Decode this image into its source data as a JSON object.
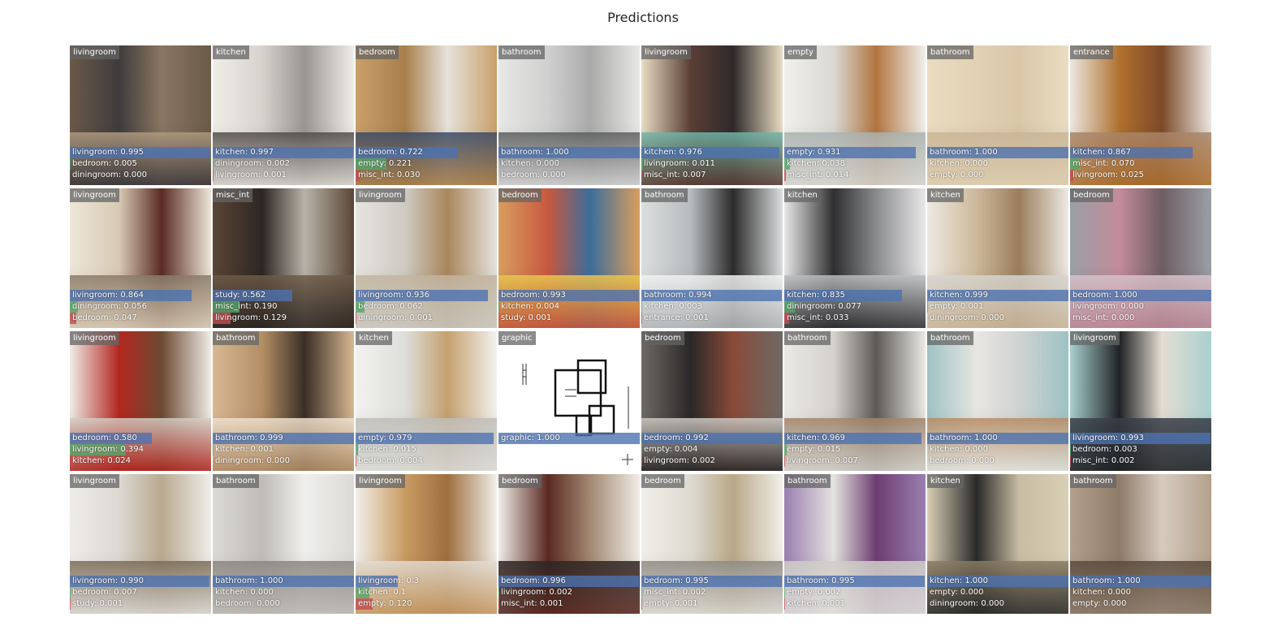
{
  "title": "Predictions",
  "colors": {
    "bar_top": "#4c72b0",
    "bar_second": "#55a868",
    "bar_third": "#c44e52",
    "label_bg": "#646464"
  },
  "tiles": [
    {
      "label": "livingroom",
      "palette": [
        "#6b5a49",
        "#3f3b3d",
        "#8a7662",
        "#b09a80"
      ],
      "preds": [
        {
          "name": "livingroom",
          "score": "0.995",
          "p": 0.995
        },
        {
          "name": "bedroom",
          "score": "0.005",
          "p": 0.005
        },
        {
          "name": "diningroom",
          "score": "0.000",
          "p": 0.0
        }
      ]
    },
    {
      "label": "kitchen",
      "palette": [
        "#f0ede8",
        "#d7d2cc",
        "#9a9590",
        "#514c48"
      ],
      "preds": [
        {
          "name": "kitchen",
          "score": "0.997",
          "p": 0.997
        },
        {
          "name": "diningroom",
          "score": "0.002",
          "p": 0.002
        },
        {
          "name": "livingroom",
          "score": "0.001",
          "p": 0.001
        }
      ]
    },
    {
      "label": "bedroom",
      "palette": [
        "#c9a06a",
        "#a87f4b",
        "#e6e2dc",
        "#3a4a68"
      ],
      "preds": [
        {
          "name": "bedroom",
          "score": "0.722",
          "p": 0.722
        },
        {
          "name": "empty",
          "score": "0.221",
          "p": 0.221
        },
        {
          "name": "misc_int",
          "score": "0.030",
          "p": 0.03
        }
      ]
    },
    {
      "label": "bathroom",
      "palette": [
        "#e8e8e6",
        "#cfd0cf",
        "#a9aaa9",
        "#5d5e5e"
      ],
      "preds": [
        {
          "name": "bathroom",
          "score": "1.000",
          "p": 1.0
        },
        {
          "name": "kitchen",
          "score": "0.000",
          "p": 0.0
        },
        {
          "name": "bedroom",
          "score": "0.000",
          "p": 0.0
        }
      ]
    },
    {
      "label": "livingroom",
      "palette": [
        "#e9dcc3",
        "#5a3e35",
        "#2f2a2a",
        "#6fb5a8"
      ],
      "preds": [
        {
          "name": "kitchen",
          "score": "0.976",
          "p": 0.976
        },
        {
          "name": "livingroom",
          "score": "0.011",
          "p": 0.011
        },
        {
          "name": "misc_int",
          "score": "0.007",
          "p": 0.007
        }
      ]
    },
    {
      "label": "empty",
      "palette": [
        "#f1f0ec",
        "#dad8d2",
        "#b27540",
        "#a9b2b0"
      ],
      "preds": [
        {
          "name": "empty",
          "score": "0.931",
          "p": 0.931
        },
        {
          "name": "kitchen",
          "score": "0.038",
          "p": 0.038
        },
        {
          "name": "misc_int",
          "score": "0.014",
          "p": 0.014
        }
      ]
    },
    {
      "label": "bathroom",
      "palette": [
        "#eadcc2",
        "#e2d1b3",
        "#d9c7a7",
        "#c9b595"
      ],
      "preds": [
        {
          "name": "bathroom",
          "score": "1.000",
          "p": 1.0
        },
        {
          "name": "kitchen",
          "score": "0.000",
          "p": 0.0
        },
        {
          "name": "empty",
          "score": "0.000",
          "p": 0.0
        }
      ]
    },
    {
      "label": "entrance",
      "palette": [
        "#ece8e2",
        "#b0702f",
        "#7d4a28",
        "#a9856a"
      ],
      "preds": [
        {
          "name": "kitchen",
          "score": "0.867",
          "p": 0.867
        },
        {
          "name": "misc_int",
          "score": "0.070",
          "p": 0.07
        },
        {
          "name": "livingroom",
          "score": "0.025",
          "p": 0.025
        }
      ]
    },
    {
      "label": "livingroom",
      "palette": [
        "#eee6d8",
        "#d7c9b3",
        "#5a2b24",
        "#8a7a68"
      ],
      "preds": [
        {
          "name": "livingroom",
          "score": "0.864",
          "p": 0.864
        },
        {
          "name": "diningroom",
          "score": "0.056",
          "p": 0.056
        },
        {
          "name": "bedroom",
          "score": "0.047",
          "p": 0.047
        }
      ]
    },
    {
      "label": "misc_int",
      "palette": [
        "#5a4637",
        "#2d2622",
        "#b8b3a8",
        "#6e5b48"
      ],
      "preds": [
        {
          "name": "study",
          "score": "0.562",
          "p": 0.562
        },
        {
          "name": "misc_int",
          "score": "0.190",
          "p": 0.19
        },
        {
          "name": "livingroom",
          "score": "0.129",
          "p": 0.129
        }
      ]
    },
    {
      "label": "livingroom",
      "palette": [
        "#e6e4df",
        "#cfcac2",
        "#a9875d",
        "#c2b59e"
      ],
      "preds": [
        {
          "name": "livingroom",
          "score": "0.936",
          "p": 0.936
        },
        {
          "name": "bedroom",
          "score": "0.062",
          "p": 0.062
        },
        {
          "name": "diningroom",
          "score": "0.001",
          "p": 0.001
        }
      ]
    },
    {
      "label": "bedroom",
      "palette": [
        "#d99e5e",
        "#c8583f",
        "#3d6d9b",
        "#e8c84f"
      ],
      "preds": [
        {
          "name": "bedroom",
          "score": "0.993",
          "p": 0.993
        },
        {
          "name": "kitchen",
          "score": "0.004",
          "p": 0.004
        },
        {
          "name": "study",
          "score": "0.001",
          "p": 0.001
        }
      ]
    },
    {
      "label": "bathroom",
      "palette": [
        "#dcdedf",
        "#b7babc",
        "#2b2b2b",
        "#f2f2f2"
      ],
      "preds": [
        {
          "name": "bathroom",
          "score": "0.994",
          "p": 0.994
        },
        {
          "name": "kitchen",
          "score": "0.003",
          "p": 0.003
        },
        {
          "name": "entrance",
          "score": "0.001",
          "p": 0.001
        }
      ]
    },
    {
      "label": "kitchen",
      "palette": [
        "#e8e8e8",
        "#2f2f31",
        "#8a8b8d",
        "#bdbebf"
      ],
      "preds": [
        {
          "name": "kitchen",
          "score": "0.835",
          "p": 0.835
        },
        {
          "name": "diningroom",
          "score": "0.077",
          "p": 0.077
        },
        {
          "name": "misc_int",
          "score": "0.033",
          "p": 0.033
        }
      ]
    },
    {
      "label": "kitchen",
      "palette": [
        "#ede9e3",
        "#cdb89a",
        "#9a7e5d",
        "#d6d4d0"
      ],
      "preds": [
        {
          "name": "kitchen",
          "score": "0.999",
          "p": 0.999
        },
        {
          "name": "empty",
          "score": "0.001",
          "p": 0.001
        },
        {
          "name": "diningroom",
          "score": "0.000",
          "p": 0.0
        }
      ]
    },
    {
      "label": "bedroom",
      "palette": [
        "#9aa0a5",
        "#c38b9b",
        "#6e5d63",
        "#d7c3ca"
      ],
      "preds": [
        {
          "name": "bedroom",
          "score": "1.000",
          "p": 1.0
        },
        {
          "name": "livingroom",
          "score": "0.000",
          "p": 0.0
        },
        {
          "name": "misc_int",
          "score": "0.000",
          "p": 0.0
        }
      ]
    },
    {
      "label": "livingroom",
      "palette": [
        "#efece6",
        "#b3261f",
        "#6d4a32",
        "#d3cdc3"
      ],
      "preds": [
        {
          "name": "bedroom",
          "score": "0.580",
          "p": 0.58
        },
        {
          "name": "livingroom",
          "score": "0.394",
          "p": 0.394
        },
        {
          "name": "kitchen",
          "score": "0.024",
          "p": 0.024
        }
      ]
    },
    {
      "label": "bathroom",
      "palette": [
        "#d8b893",
        "#b38e65",
        "#3a2e26",
        "#efe2cf"
      ],
      "preds": [
        {
          "name": "bathroom",
          "score": "0.999",
          "p": 0.999
        },
        {
          "name": "kitchen",
          "score": "0.001",
          "p": 0.001
        },
        {
          "name": "diningroom",
          "score": "0.000",
          "p": 0.0
        }
      ]
    },
    {
      "label": "kitchen",
      "palette": [
        "#f2f2f0",
        "#dededb",
        "#c5a06e",
        "#bfbdb8"
      ],
      "preds": [
        {
          "name": "empty",
          "score": "0.979",
          "p": 0.979
        },
        {
          "name": "kitchen",
          "score": "0.015",
          "p": 0.015
        },
        {
          "name": "bedroom",
          "score": "0.004",
          "p": 0.004
        }
      ]
    },
    {
      "label": "graphic",
      "palette": [
        "#ffffff",
        "#ffffff",
        "#ffffff",
        "#ffffff"
      ],
      "floorplan": true,
      "preds": [
        {
          "name": "graphic",
          "score": "1.000",
          "p": 1.0
        }
      ]
    },
    {
      "label": "bedroom",
      "palette": [
        "#6e6a65",
        "#2a2828",
        "#8a4a3a",
        "#cfcac3"
      ],
      "preds": [
        {
          "name": "bedroom",
          "score": "0.992",
          "p": 0.992
        },
        {
          "name": "empty",
          "score": "0.004",
          "p": 0.004
        },
        {
          "name": "livingroom",
          "score": "0.002",
          "p": 0.002
        }
      ]
    },
    {
      "label": "bathroom",
      "palette": [
        "#ebe9e4",
        "#d4d1cb",
        "#5d5a56",
        "#a0846a"
      ],
      "preds": [
        {
          "name": "kitchen",
          "score": "0.969",
          "p": 0.969
        },
        {
          "name": "empty",
          "score": "0.015",
          "p": 0.015
        },
        {
          "name": "livingroom",
          "score": "0.007",
          "p": 0.007
        }
      ]
    },
    {
      "label": "bathroom",
      "palette": [
        "#9ec2c4",
        "#e8e6e1",
        "#cfd3d2",
        "#b68b62"
      ],
      "preds": [
        {
          "name": "bathroom",
          "score": "1.000",
          "p": 1.0
        },
        {
          "name": "kitchen",
          "score": "0.000",
          "p": 0.0
        },
        {
          "name": "bedroom",
          "score": "0.000",
          "p": 0.0
        }
      ]
    },
    {
      "label": "livingroom",
      "palette": [
        "#a9d0cf",
        "#202224",
        "#e4ddd2",
        "#3a3f4a"
      ],
      "preds": [
        {
          "name": "livingroom",
          "score": "0.993",
          "p": 0.993
        },
        {
          "name": "bedroom",
          "score": "0.003",
          "p": 0.003
        },
        {
          "name": "misc_int",
          "score": "0.002",
          "p": 0.002
        }
      ]
    },
    {
      "label": "livingroom",
      "palette": [
        "#efedea",
        "#dcd8d2",
        "#b9a98f",
        "#7a6a55"
      ],
      "preds": [
        {
          "name": "livingroom",
          "score": "0.990",
          "p": 0.99
        },
        {
          "name": "bedroom",
          "score": "0.007",
          "p": 0.007
        },
        {
          "name": "study",
          "score": "0.001",
          "p": 0.001
        }
      ]
    },
    {
      "label": "bathroom",
      "palette": [
        "#dcdad6",
        "#bfbcb6",
        "#efefed",
        "#8a8580"
      ],
      "preds": [
        {
          "name": "bathroom",
          "score": "1.000",
          "p": 1.0
        },
        {
          "name": "kitchen",
          "score": "0.000",
          "p": 0.0
        },
        {
          "name": "bedroom",
          "score": "0.000",
          "p": 0.0
        }
      ]
    },
    {
      "label": "livingroom",
      "palette": [
        "#f2efea",
        "#c99b62",
        "#9e6f3f",
        "#e2dcd3"
      ],
      "preds": [
        {
          "name": "livingroom",
          "score": "0.3",
          "p": 0.3
        },
        {
          "name": "kitchen",
          "score": "0.1",
          "p": 0.1
        },
        {
          "name": "empty",
          "score": "0.120",
          "p": 0.12
        }
      ]
    },
    {
      "label": "bedroom",
      "palette": [
        "#f0ede8",
        "#5a2a22",
        "#a38972",
        "#2c2524"
      ],
      "preds": [
        {
          "name": "bedroom",
          "score": "0.996",
          "p": 0.996
        },
        {
          "name": "livingroom",
          "score": "0.002",
          "p": 0.002
        },
        {
          "name": "misc_int",
          "score": "0.001",
          "p": 0.001
        }
      ]
    },
    {
      "label": "bedroom",
      "palette": [
        "#f1efe9",
        "#dedad1",
        "#b8a887",
        "#8d8a83"
      ],
      "preds": [
        {
          "name": "bedroom",
          "score": "0.995",
          "p": 0.995
        },
        {
          "name": "misc_int",
          "score": "0.002",
          "p": 0.002
        },
        {
          "name": "empty",
          "score": "0.001",
          "p": 0.001
        }
      ]
    },
    {
      "label": "bathroom",
      "palette": [
        "#9a7fb0",
        "#e5e3e0",
        "#6d3d71",
        "#cfcdc8"
      ],
      "preds": [
        {
          "name": "bathroom",
          "score": "0.995",
          "p": 0.995
        },
        {
          "name": "empty",
          "score": "0.002",
          "p": 0.002
        },
        {
          "name": "kitchen",
          "score": "0.001",
          "p": 0.001
        }
      ]
    },
    {
      "label": "kitchen",
      "palette": [
        "#d9cfb5",
        "#2a2a2a",
        "#c8bda3",
        "#8a7c63"
      ],
      "preds": [
        {
          "name": "kitchen",
          "score": "1.000",
          "p": 1.0
        },
        {
          "name": "empty",
          "score": "0.000",
          "p": 0.0
        },
        {
          "name": "diningroom",
          "score": "0.000",
          "p": 0.0
        }
      ]
    },
    {
      "label": "bathroom",
      "palette": [
        "#b3a08c",
        "#8e7b69",
        "#d6cbbf",
        "#5a4a3d"
      ],
      "preds": [
        {
          "name": "bathroom",
          "score": "1.000",
          "p": 1.0
        },
        {
          "name": "kitchen",
          "score": "0.000",
          "p": 0.0
        },
        {
          "name": "empty",
          "score": "0.000",
          "p": 0.0
        }
      ]
    }
  ]
}
